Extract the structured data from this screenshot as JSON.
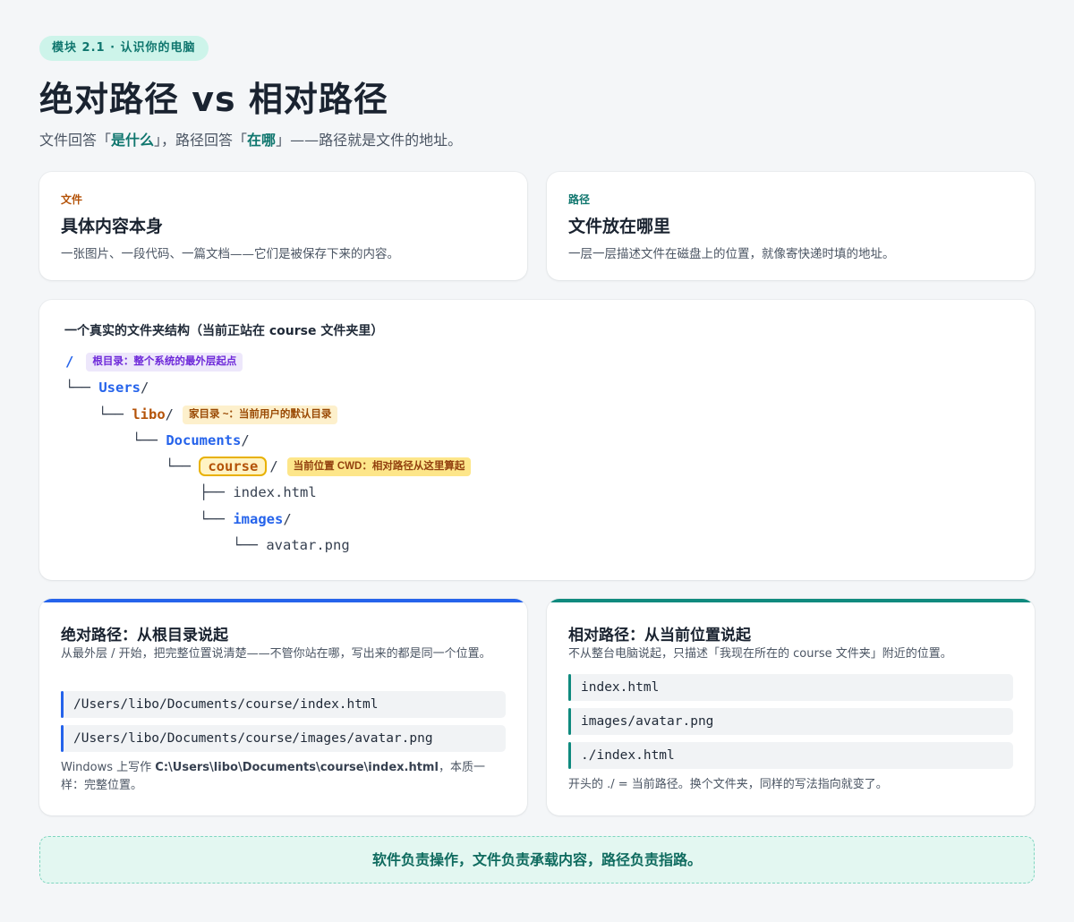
{
  "header": {
    "module_badge": "模块 2.1 · 认识你的电脑",
    "title": "绝对路径 vs 相对路径",
    "subtitle": {
      "p1": "文件回答「",
      "h1": "是什么",
      "p2": "」，路径回答「",
      "h2": "在哪",
      "p3": "」——路径就是文件的地址。"
    }
  },
  "definitions": [
    {
      "kicker": "文件",
      "title": "具体内容本身",
      "desc": "一张图片、一段代码、一篇文档——它们是被保存下来的内容。",
      "kicker_color": "#b45309"
    },
    {
      "kicker": "路径",
      "title": "文件放在哪里",
      "desc": "一层一层描述文件在磁盘上的位置，就像寄快递时填的地址。",
      "kicker_color": "#0f766e"
    }
  ],
  "tree": {
    "heading": "一个真实的文件夹结构（当前正站在 course 文件夹里）",
    "root": "/",
    "root_tag": "根目录：整个系统的最外层起点",
    "users": "Users",
    "libo": "libo",
    "home_tag": "家目录 ~：当前用户的默认目录",
    "documents": "Documents",
    "course": "course",
    "cwd_tag": "当前位置 CWD：相对路径从这里算起",
    "index_file": "index.html",
    "images": "images",
    "avatar_file": "avatar.png",
    "branch_last": "└── ",
    "branch_mid": "├── ",
    "slash": "/"
  },
  "absolute": {
    "title": "绝对路径：从根目录说起",
    "desc": "从最外层 / 开始，把完整位置说清楚——不管你站在哪，写出来的都是同一个位置。",
    "examples": [
      "/Users/libo/Documents/course/index.html",
      "/Users/libo/Documents/course/images/avatar.png"
    ],
    "note_pre": "Windows 上写作 ",
    "note_bold": "C:\\Users\\libo\\Documents\\course\\index.html",
    "note_post": "，本质一样：完整位置。",
    "accent": "#2563eb"
  },
  "relative": {
    "title": "相对路径：从当前位置说起",
    "desc": "不从整台电脑说起，只描述「我现在所在的 course 文件夹」附近的位置。",
    "examples": [
      "index.html",
      "images/avatar.png",
      "./index.html"
    ],
    "note": "开头的 ./ = 当前路径。换个文件夹，同样的写法指向就变了。",
    "accent": "#0f8a7e"
  },
  "footer": "软件负责操作，文件负责承载内容，路径负责指路。"
}
